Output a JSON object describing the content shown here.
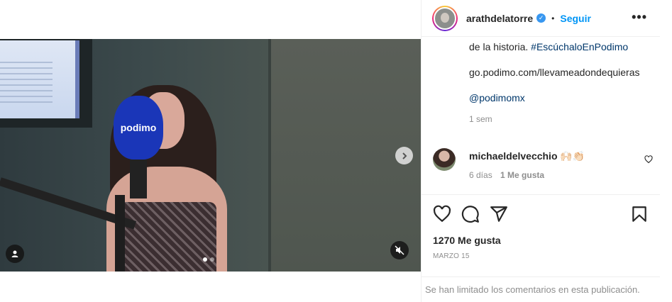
{
  "header": {
    "username": "arathdelatorre",
    "separator": "•",
    "follow_label": "Seguir",
    "more_label": "•••",
    "verified_mark": "✓"
  },
  "media": {
    "mic_brand": "podimo",
    "next_icon": "chevron-right-icon",
    "user_icon": "user-tag-icon",
    "mute_icon": "speaker-muted-icon",
    "carousel_total": 2,
    "carousel_active": 1
  },
  "caption": {
    "line1_text": "de la historia. ",
    "hashtag": "#EscúchaloEnPodimo",
    "link": "go.podimo.com/llevameadondequieras",
    "mention": "@podimomx",
    "time": "1 sem"
  },
  "comment": {
    "username": "michaeldelvecchio",
    "text": "🙌🏻👏🏻",
    "time": "6 días",
    "likes": "1 Me gusta"
  },
  "actions": {
    "likes_count": "1270 Me gusta",
    "date": "MARZO 15"
  },
  "footer": {
    "text": "Se han limitado los comentarios en esta publicación."
  },
  "colors": {
    "accent": "#0095f6",
    "verified": "#3897f0",
    "link": "#00376b",
    "muted": "#8e8e8e"
  }
}
